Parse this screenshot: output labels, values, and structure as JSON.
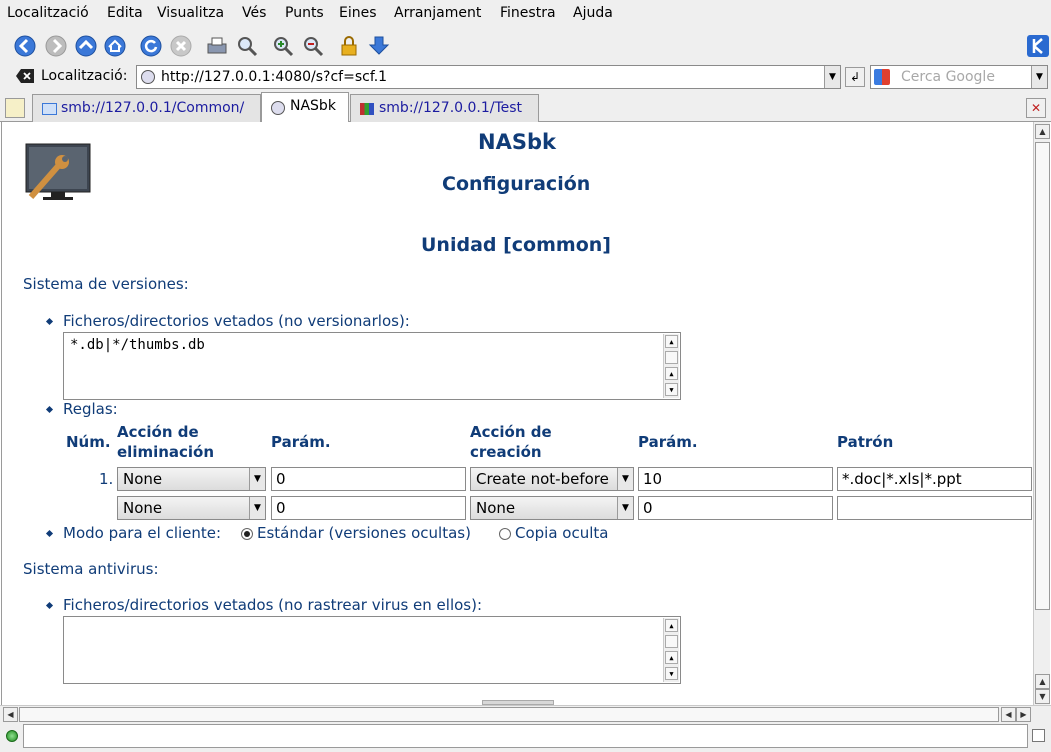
{
  "menu": [
    "Localització",
    "Edita",
    "Visualitza",
    "Vés",
    "Punts",
    "Eines",
    "Arranjament",
    "Finestra",
    "Ajuda"
  ],
  "location": {
    "label": "Localització:",
    "url": "http://127.0.0.1:4080/s?cf=scf.1"
  },
  "search": {
    "placeholder": "Cerca Google"
  },
  "tabs": [
    {
      "label": "smb://127.0.0.1/Common/"
    },
    {
      "label": "NASbk"
    },
    {
      "label": "smb://127.0.0.1/Test"
    }
  ],
  "page": {
    "title": "NASbk",
    "subtitle": "Configuración",
    "unit": "Unidad [common]",
    "versions_heading": "Sistema de versiones:",
    "veto_label": "Ficheros/directorios vetados (no versionarlos):",
    "veto_value": "*.db|*/thumbs.db",
    "rules_label": "Reglas:",
    "table_headers": {
      "num": "Núm.",
      "del_action": "Acción de eliminación",
      "param1": "Parám.",
      "create_action": "Acción de creación",
      "param2": "Parám.",
      "pattern": "Patrón"
    },
    "rules": [
      {
        "num": "1.",
        "del_action": "None",
        "param1": "0",
        "create_action": "Create not-before",
        "param2": "10",
        "pattern": "*.doc|*.xls|*.ppt"
      },
      {
        "num": "",
        "del_action": "None",
        "param1": "0",
        "create_action": "None",
        "param2": "0",
        "pattern": ""
      }
    ],
    "client_mode_label": "Modo para el cliente:",
    "mode_standard": "Estándar (versiones ocultas)",
    "mode_hidden": "Copia oculta",
    "antivirus_heading": "Sistema antivirus:",
    "av_veto_label": "Ficheros/directorios vetados (no rastrear virus en ellos):",
    "av_veto_value": ""
  }
}
